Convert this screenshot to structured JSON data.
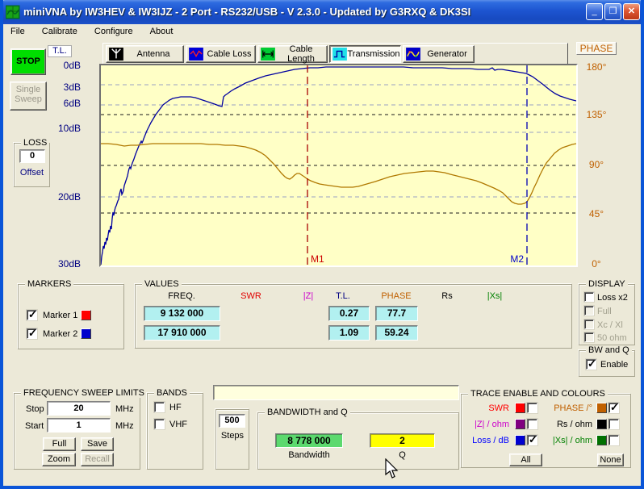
{
  "window": {
    "title": "miniVNA by IW3HEV & IW3IJZ - 2 Port - RS232/USB - V 2.3.0 - Updated by G3RXQ & DK3SI",
    "menu": [
      "File",
      "Calibrate",
      "Configure",
      "About"
    ],
    "minimize_glyph": "_",
    "maximize_glyph": "❒",
    "close_glyph": "✕"
  },
  "toolbar": {
    "buttons": [
      {
        "label": "Antenna",
        "icon": "antenna-icon",
        "pressed": false
      },
      {
        "label": "Cable Loss",
        "icon": "cable-loss-icon",
        "pressed": false
      },
      {
        "label": "Cable Length",
        "icon": "cable-length-icon",
        "pressed": false
      },
      {
        "label": "Transmission",
        "icon": "transmission-icon",
        "pressed": true
      },
      {
        "label": "Generator",
        "icon": "generator-icon",
        "pressed": false
      }
    ]
  },
  "left_panel": {
    "stop_label": "STOP",
    "stop_color": "#00DE00",
    "single_sweep_label": "Single Sweep",
    "loss": {
      "title": "LOSS",
      "value": "0",
      "offset_label": "Offset"
    }
  },
  "axis_left": {
    "title": "T.L.",
    "ticks": [
      {
        "label": "0dB"
      },
      {
        "label": "3dB"
      },
      {
        "label": "6dB"
      },
      {
        "label": "10dB"
      },
      {
        "label": "20dB"
      },
      {
        "label": "30dB"
      }
    ]
  },
  "axis_right": {
    "title": "PHASE",
    "ticks": [
      {
        "label": "180°"
      },
      {
        "label": "135°"
      },
      {
        "label": "90°"
      },
      {
        "label": "45°"
      },
      {
        "label": "0°"
      }
    ]
  },
  "chart": {
    "type": "line",
    "background": "#FFFFC6",
    "x_range_mhz": [
      1,
      20
    ],
    "left_axis": {
      "label": "T.L.",
      "unit": "dB",
      "ticks": [
        0,
        3,
        6,
        10,
        20,
        30
      ]
    },
    "right_axis": {
      "label": "PHASE",
      "unit": "°",
      "ticks": [
        180,
        135,
        90,
        45,
        0
      ]
    },
    "gridlines_db_y": [
      105,
      130,
      164,
      244
    ],
    "gridlines_phase_y": [
      142,
      205,
      264
    ],
    "markers": [
      {
        "label": "M1",
        "x": 377,
        "freq_hz": "9 132 000",
        "color": "#A80000",
        "label_color": "#CC0000",
        "anchor": "start",
        "label_x": 381
      },
      {
        "label": "M2",
        "x": 649,
        "freq_hz": "17 910 000",
        "color": "#0000B4",
        "label_color": "#0000CC",
        "anchor": "end",
        "label_x": 645
      }
    ],
    "series": [
      {
        "name": "Loss / dB",
        "color": "#0000A0",
        "points": [
          [
            121,
            328
          ],
          [
            122,
            318
          ],
          [
            123,
            312
          ],
          [
            124,
            305
          ],
          [
            125,
            308
          ],
          [
            126,
            300
          ],
          [
            127,
            303
          ],
          [
            128,
            295
          ],
          [
            129,
            298
          ],
          [
            130,
            291
          ],
          [
            131,
            285
          ],
          [
            132,
            288
          ],
          [
            133,
            280
          ],
          [
            134,
            284
          ],
          [
            135,
            271
          ],
          [
            136,
            263
          ],
          [
            137,
            267
          ],
          [
            138,
            261
          ],
          [
            139,
            257
          ],
          [
            140,
            255
          ],
          [
            141,
            252
          ],
          [
            142,
            249
          ],
          [
            143,
            247
          ],
          [
            144,
            241
          ],
          [
            145,
            237
          ],
          [
            146,
            234
          ],
          [
            147,
            241
          ],
          [
            148,
            239
          ],
          [
            149,
            236
          ],
          [
            150,
            230
          ],
          [
            151,
            227
          ],
          [
            152,
            224
          ],
          [
            153,
            221
          ],
          [
            154,
            218
          ],
          [
            155,
            213
          ],
          [
            156,
            209
          ],
          [
            157,
            207
          ],
          [
            158,
            209
          ],
          [
            159,
            205
          ],
          [
            160,
            202
          ],
          [
            162,
            197
          ],
          [
            164,
            191
          ],
          [
            166,
            186
          ],
          [
            168,
            181
          ],
          [
            170,
            177
          ],
          [
            171,
            175
          ],
          [
            172,
            177
          ],
          [
            173,
            175
          ],
          [
            174,
            172
          ],
          [
            176,
            167
          ],
          [
            178,
            162
          ],
          [
            180,
            158
          ],
          [
            183,
            152
          ],
          [
            186,
            147
          ],
          [
            189,
            142
          ],
          [
            192,
            138
          ],
          [
            195,
            134
          ],
          [
            198,
            130
          ],
          [
            202,
            127
          ],
          [
            206,
            124
          ],
          [
            210,
            122
          ],
          [
            215,
            121
          ],
          [
            220,
            120
          ],
          [
            226,
            120
          ],
          [
            232,
            120
          ],
          [
            238,
            121
          ],
          [
            244,
            123
          ],
          [
            250,
            125
          ],
          [
            256,
            127
          ],
          [
            262,
            129
          ],
          [
            267,
            131
          ],
          [
            271,
            132
          ],
          [
            272,
            126
          ],
          [
            273,
            120
          ],
          [
            275,
            118
          ],
          [
            278,
            116
          ],
          [
            282,
            113
          ],
          [
            287,
            110
          ],
          [
            293,
            107
          ],
          [
            300,
            103
          ],
          [
            308,
            100
          ],
          [
            316,
            97
          ],
          [
            325,
            94
          ],
          [
            334,
            92
          ],
          [
            343,
            90
          ],
          [
            352,
            88
          ],
          [
            361,
            86
          ],
          [
            370,
            85
          ],
          [
            380,
            84
          ],
          [
            390,
            84
          ],
          [
            400,
            83
          ],
          [
            412,
            83
          ],
          [
            424,
            83
          ],
          [
            436,
            83
          ],
          [
            448,
            83
          ],
          [
            460,
            83
          ],
          [
            472,
            83
          ],
          [
            484,
            83
          ],
          [
            496,
            83
          ],
          [
            508,
            84
          ],
          [
            520,
            84
          ],
          [
            532,
            84
          ],
          [
            544,
            84
          ],
          [
            556,
            85
          ],
          [
            568,
            85
          ],
          [
            578,
            85
          ],
          [
            588,
            86
          ],
          [
            596,
            86
          ],
          [
            602,
            86
          ],
          [
            606,
            84
          ],
          [
            609,
            87
          ],
          [
            613,
            86
          ],
          [
            618,
            86
          ],
          [
            624,
            87
          ],
          [
            630,
            88
          ],
          [
            636,
            89
          ],
          [
            642,
            90
          ],
          [
            648,
            91
          ],
          [
            652,
            93
          ],
          [
            656,
            95
          ],
          [
            660,
            98
          ],
          [
            664,
            101
          ],
          [
            668,
            104
          ],
          [
            673,
            108
          ],
          [
            678,
            112
          ],
          [
            684,
            116
          ],
          [
            690,
            119
          ],
          [
            696,
            121
          ],
          [
            702,
            123
          ],
          [
            710,
            125
          ]
        ]
      },
      {
        "name": "PHASE /°",
        "color": "#B07800",
        "points": [
          [
            121,
            178
          ],
          [
            130,
            178
          ],
          [
            140,
            179
          ],
          [
            150,
            181
          ],
          [
            158,
            180
          ],
          [
            166,
            180
          ],
          [
            175,
            179
          ],
          [
            185,
            178
          ],
          [
            195,
            178
          ],
          [
            205,
            178
          ],
          [
            215,
            178
          ],
          [
            225,
            178
          ],
          [
            235,
            178
          ],
          [
            245,
            178
          ],
          [
            255,
            179
          ],
          [
            265,
            179
          ],
          [
            275,
            180
          ],
          [
            285,
            180
          ],
          [
            293,
            181
          ],
          [
            300,
            182
          ],
          [
            307,
            184
          ],
          [
            313,
            186
          ],
          [
            319,
            189
          ],
          [
            325,
            193
          ],
          [
            330,
            198
          ],
          [
            335,
            203
          ],
          [
            340,
            209
          ],
          [
            345,
            215
          ],
          [
            349,
            219
          ],
          [
            352,
            221
          ],
          [
            355,
            222
          ],
          [
            358,
            220
          ],
          [
            361,
            217
          ],
          [
            364,
            215
          ],
          [
            367,
            215
          ],
          [
            370,
            217
          ],
          [
            373,
            219
          ],
          [
            377,
            222
          ],
          [
            381,
            224
          ],
          [
            386,
            226
          ],
          [
            392,
            228
          ],
          [
            398,
            229
          ],
          [
            405,
            230
          ],
          [
            412,
            231
          ],
          [
            419,
            232
          ],
          [
            426,
            232
          ],
          [
            433,
            232
          ],
          [
            440,
            231
          ],
          [
            447,
            229
          ],
          [
            454,
            227
          ],
          [
            461,
            225
          ],
          [
            470,
            222
          ],
          [
            479,
            219
          ],
          [
            488,
            217
          ],
          [
            497,
            215
          ],
          [
            506,
            214
          ],
          [
            515,
            213
          ],
          [
            524,
            212
          ],
          [
            533,
            212
          ],
          [
            540,
            213
          ],
          [
            547,
            214
          ],
          [
            554,
            216
          ],
          [
            562,
            218
          ],
          [
            570,
            220
          ],
          [
            578,
            222
          ],
          [
            586,
            224
          ],
          [
            594,
            227
          ],
          [
            601,
            230
          ],
          [
            608,
            233
          ],
          [
            614,
            236
          ],
          [
            619,
            239
          ],
          [
            623,
            243
          ],
          [
            627,
            247
          ],
          [
            630,
            250
          ],
          [
            634,
            252
          ],
          [
            638,
            253
          ],
          [
            642,
            253
          ],
          [
            646,
            252
          ],
          [
            649,
            250
          ],
          [
            652,
            245
          ],
          [
            655,
            239
          ],
          [
            658,
            232
          ],
          [
            661,
            226
          ],
          [
            665,
            217
          ],
          [
            669,
            209
          ],
          [
            673,
            202
          ],
          [
            678,
            196
          ],
          [
            683,
            190
          ],
          [
            688,
            186
          ],
          [
            693,
            183
          ],
          [
            699,
            181
          ],
          [
            705,
            179
          ],
          [
            710,
            178
          ]
        ]
      }
    ]
  },
  "markers_group": {
    "title": "MARKERS",
    "items": [
      {
        "label": "Marker 1",
        "checked": true,
        "color": "#FF0000"
      },
      {
        "label": "Marker 2",
        "checked": true,
        "color": "#0000CC"
      }
    ]
  },
  "values_group": {
    "title": "VALUES",
    "headers": [
      {
        "label": "FREQ.",
        "color": "#000000"
      },
      {
        "label": "SWR",
        "color": "#E00000"
      },
      {
        "label": "|Z|",
        "color": "#CC00CC"
      },
      {
        "label": "T.L.",
        "color": "#000080"
      },
      {
        "label": "PHASE",
        "color": "#C06000"
      },
      {
        "label": "Rs",
        "color": "#000000"
      },
      {
        "label": "|Xs|",
        "color": "#008000"
      }
    ],
    "freq": [
      "9 132 000",
      "17 910 000"
    ],
    "tl": [
      "0.27",
      "1.09"
    ],
    "phase": [
      "77.7",
      "59.24"
    ]
  },
  "display_group": {
    "title": "DISPLAY",
    "items": [
      {
        "label": "Loss x2",
        "checked": false,
        "disabled": false
      },
      {
        "label": "Full",
        "checked": false,
        "disabled": true
      },
      {
        "label": "Xc / Xl",
        "checked": false,
        "disabled": true
      },
      {
        "label": "50 ohm",
        "checked": false,
        "disabled": true
      }
    ]
  },
  "bwq_group": {
    "title": "BW and Q",
    "enable_label": "Enable",
    "enable_checked": true
  },
  "sweep_group": {
    "title": "FREQUENCY SWEEP LIMITS",
    "stop_label": "Stop",
    "stop_value": "20",
    "start_label": "Start",
    "start_value": "1",
    "unit": "MHz",
    "full_label": "Full",
    "save_label": "Save",
    "zoom_label": "Zoom",
    "recall_label": "Recall"
  },
  "bands_group": {
    "title": "BANDS",
    "items": [
      {
        "label": "HF",
        "checked": false
      },
      {
        "label": "VHF",
        "checked": false
      }
    ]
  },
  "message_field": {
    "value": ""
  },
  "steps_group": {
    "value": "500",
    "label": "Steps"
  },
  "bandwidth_group": {
    "title": "BANDWIDTH and Q",
    "bandwidth_value": "8 778 000",
    "bandwidth_label": "Bandwidth",
    "bandwidth_color": "#5CD96E",
    "q_value": "2",
    "q_label": "Q",
    "q_color": "#FFFF00"
  },
  "trace_group": {
    "title": "TRACE ENABLE AND COLOURS",
    "items": [
      {
        "label": "SWR",
        "color": "#FF0000",
        "swatch": "#FF0000",
        "checked": false
      },
      {
        "label": "PHASE /°",
        "color": "#C06000",
        "swatch": "#C06000",
        "checked": true
      },
      {
        "label": "|Z| / ohm",
        "color": "#CC00CC",
        "swatch": "#800080",
        "checked": false
      },
      {
        "label": "Rs / ohm",
        "color": "#000000",
        "swatch": "#000000",
        "checked": false
      },
      {
        "label": "Loss / dB",
        "color": "#0000FF",
        "swatch": "#0000D0",
        "checked": true
      },
      {
        "label": "|Xs| / ohm",
        "color": "#008000",
        "swatch": "#007000",
        "checked": false
      }
    ],
    "all_label": "All",
    "none_label": "None"
  }
}
